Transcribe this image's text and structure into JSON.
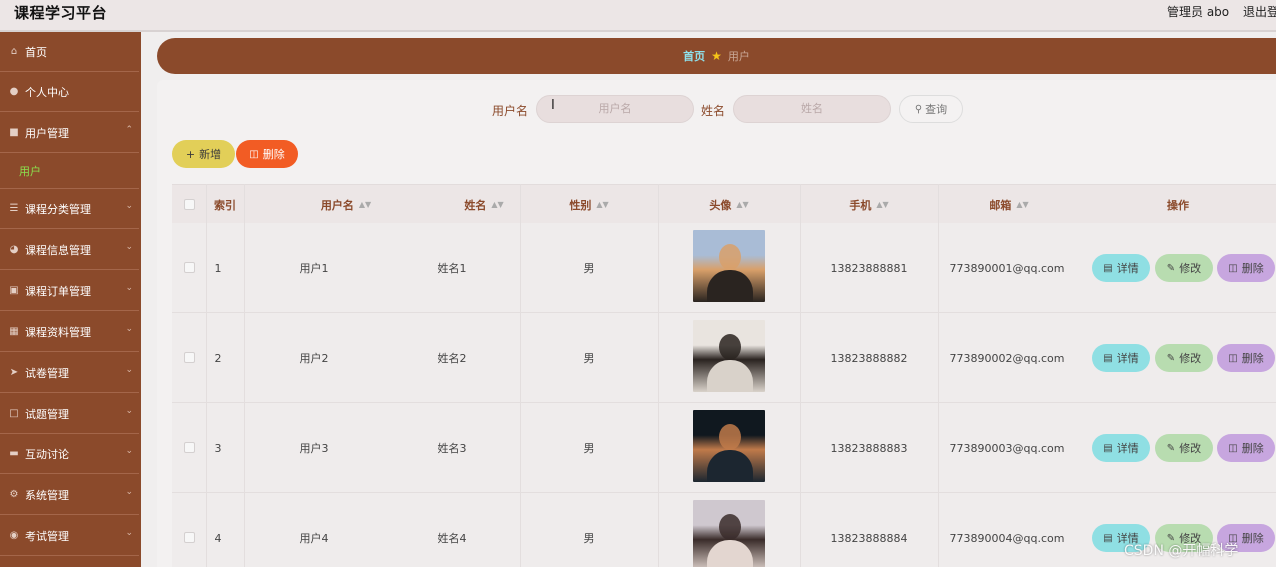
{
  "header": {
    "title": "课程学习平台",
    "admin": "管理员 abo",
    "logout": "退出登录"
  },
  "sidebar": {
    "items": [
      {
        "label": "首页",
        "icon": "home-icon"
      },
      {
        "label": "个人中心",
        "icon": "user-icon"
      },
      {
        "label": "用户管理",
        "icon": "folder-icon",
        "expanded": true,
        "sub": [
          "用户"
        ]
      },
      {
        "label": "课程分类管理",
        "icon": "list-icon"
      },
      {
        "label": "课程信息管理",
        "icon": "info-icon"
      },
      {
        "label": "课程订单管理",
        "icon": "order-icon"
      },
      {
        "label": "课程资料管理",
        "icon": "doc-icon"
      },
      {
        "label": "试卷管理",
        "icon": "send-icon"
      },
      {
        "label": "试题管理",
        "icon": "frame-icon"
      },
      {
        "label": "互动讨论",
        "icon": "chat-icon"
      },
      {
        "label": "系统管理",
        "icon": "settings-icon"
      },
      {
        "label": "考试管理",
        "icon": "exam-icon"
      }
    ]
  },
  "breadcrumb": {
    "home": "首页",
    "current": "用户"
  },
  "search": {
    "username_label": "用户名",
    "username_placeholder": "用户名",
    "name_label": "姓名",
    "name_placeholder": "姓名",
    "query_button": "查询"
  },
  "actions": {
    "add": "新增",
    "delete": "删除"
  },
  "table": {
    "headers": {
      "index": "索引",
      "username": "用户名",
      "name": "姓名",
      "gender": "性别",
      "avatar": "头像",
      "phone": "手机",
      "email": "邮箱",
      "ops": "操作"
    },
    "row_buttons": {
      "detail": "详情",
      "edit": "修改",
      "remove": "删除"
    },
    "rows": [
      {
        "index": "1",
        "username": "用户1",
        "name": "姓名1",
        "gender": "男",
        "phone": "13823888881",
        "email": "773890001@qq.com",
        "avatar_colors": [
          "#a9bcd6",
          "#d9a06a",
          "#2a2420"
        ]
      },
      {
        "index": "2",
        "username": "用户2",
        "name": "姓名2",
        "gender": "男",
        "phone": "13823888882",
        "email": "773890002@qq.com",
        "avatar_colors": [
          "#e9e4df",
          "#2a2320",
          "#d9d2ca"
        ]
      },
      {
        "index": "3",
        "username": "用户3",
        "name": "姓名3",
        "gender": "男",
        "phone": "13823888883",
        "email": "773890003@qq.com",
        "avatar_colors": [
          "#10181f",
          "#c07a4a",
          "#1c2630"
        ]
      },
      {
        "index": "4",
        "username": "用户4",
        "name": "姓名4",
        "gender": "男",
        "phone": "13823888884",
        "email": "773890004@qq.com",
        "avatar_colors": [
          "#cfc8cf",
          "#3a2c2a",
          "#e3d6d0"
        ]
      }
    ]
  },
  "watermark": "CSDN @开幅科学"
}
